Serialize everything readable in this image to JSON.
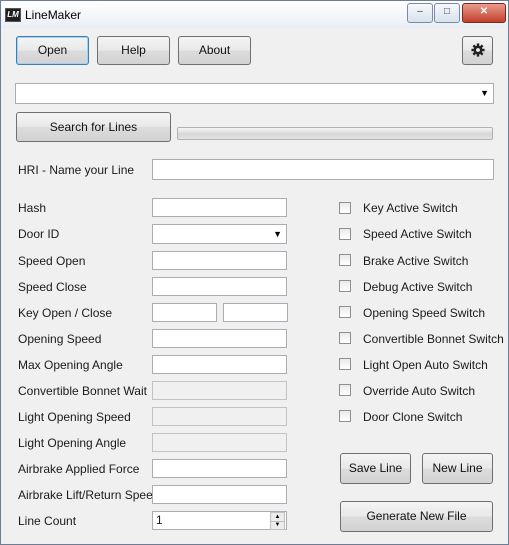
{
  "window": {
    "title": "LineMaker",
    "icon_text": "LM",
    "minimize": "–",
    "maximize": "□",
    "close": "✕"
  },
  "toolbar": {
    "open": "Open",
    "help": "Help",
    "about": "About",
    "settings_icon": "gear-icon"
  },
  "line_select": {
    "value": ""
  },
  "search": {
    "label": "Search for Lines",
    "progress": 0
  },
  "name_line": {
    "label": "HRI - Name your Line",
    "value": ""
  },
  "fields": {
    "hash": {
      "label": "Hash",
      "value": ""
    },
    "door_id": {
      "label": "Door ID",
      "value": ""
    },
    "speed_open": {
      "label": "Speed Open",
      "value": ""
    },
    "speed_close": {
      "label": "Speed Close",
      "value": ""
    },
    "key_open_close": {
      "label": "Key Open / Close",
      "open_value": "",
      "close_value": ""
    },
    "opening_speed": {
      "label": "Opening Speed",
      "value": ""
    },
    "max_opening_angle": {
      "label": "Max Opening Angle",
      "value": ""
    },
    "convertible_bonnet_wait": {
      "label": "Convertible Bonnet Wait",
      "value": ""
    },
    "light_opening_speed": {
      "label": "Light Opening Speed",
      "value": ""
    },
    "light_opening_angle": {
      "label": "Light Opening Angle",
      "value": ""
    },
    "airbrake_applied_force": {
      "label": "Airbrake Applied Force",
      "value": ""
    },
    "airbrake_lift_return_speed": {
      "label": "Airbrake Lift/Return Speed",
      "value": ""
    },
    "line_count": {
      "label": "Line Count",
      "value": "1"
    }
  },
  "switches": [
    {
      "label": "Key Active Switch",
      "checked": false
    },
    {
      "label": "Speed Active Switch",
      "checked": false
    },
    {
      "label": "Brake Active Switch",
      "checked": false
    },
    {
      "label": "Debug Active Switch",
      "checked": false
    },
    {
      "label": "Opening Speed Switch",
      "checked": false
    },
    {
      "label": "Convertible Bonnet Switch",
      "checked": false
    },
    {
      "label": "Light Open Auto Switch",
      "checked": false
    },
    {
      "label": "Override Auto Switch",
      "checked": false
    },
    {
      "label": "Door Clone Switch",
      "checked": false
    }
  ],
  "actions": {
    "save_line": "Save Line",
    "new_line": "New Line",
    "generate": "Generate New File"
  }
}
